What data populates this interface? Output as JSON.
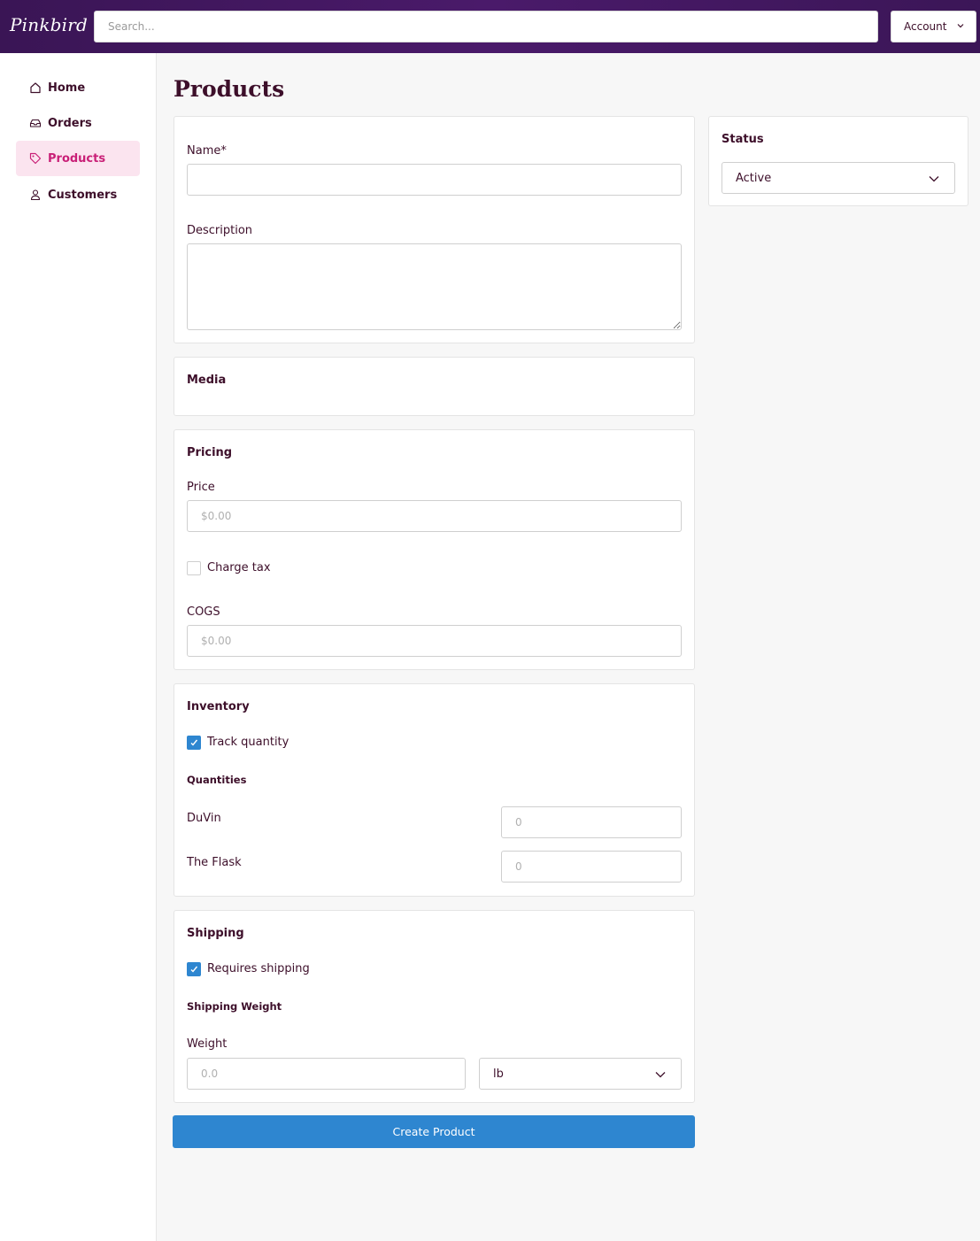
{
  "app": {
    "logo": "Pinkbird"
  },
  "header": {
    "search_placeholder": "Search...",
    "account_label": "Account"
  },
  "sidebar": {
    "items": [
      {
        "label": "Home",
        "icon": "home-icon",
        "active": false
      },
      {
        "label": "Orders",
        "icon": "inbox-icon",
        "active": false
      },
      {
        "label": "Products",
        "icon": "tag-icon",
        "active": true
      },
      {
        "label": "Customers",
        "icon": "user-icon",
        "active": false
      }
    ]
  },
  "page": {
    "title": "Products"
  },
  "details": {
    "name_label": "Name",
    "required_mark": "*",
    "name_value": "",
    "description_label": "Description",
    "description_value": ""
  },
  "media": {
    "title": "Media"
  },
  "pricing": {
    "title": "Pricing",
    "price_label": "Price",
    "price_placeholder": "$0.00",
    "charge_tax_label": "Charge tax",
    "charge_tax_checked": false,
    "cogs_label": "COGS",
    "cogs_placeholder": "$0.00"
  },
  "inventory": {
    "title": "Inventory",
    "track_quantity_label": "Track quantity",
    "track_quantity_checked": true,
    "quantities_heading": "Quantities",
    "locations": [
      {
        "name": "DuVin",
        "placeholder": "0"
      },
      {
        "name": "The Flask",
        "placeholder": "0"
      }
    ]
  },
  "shipping": {
    "title": "Shipping",
    "requires_shipping_label": "Requires shipping",
    "requires_shipping_checked": true,
    "weight_heading": "Shipping Weight",
    "weight_label": "Weight",
    "weight_placeholder": "0.0",
    "unit_selected": "lb"
  },
  "status": {
    "title": "Status",
    "selected": "Active"
  },
  "actions": {
    "create_label": "Create Product"
  },
  "colors": {
    "header_bg": "#3a1555",
    "accent_pink": "#c91f77",
    "active_nav_bg": "#fbe4ef",
    "primary_button": "#2e86d0",
    "text_dark": "#3d0f2a"
  }
}
